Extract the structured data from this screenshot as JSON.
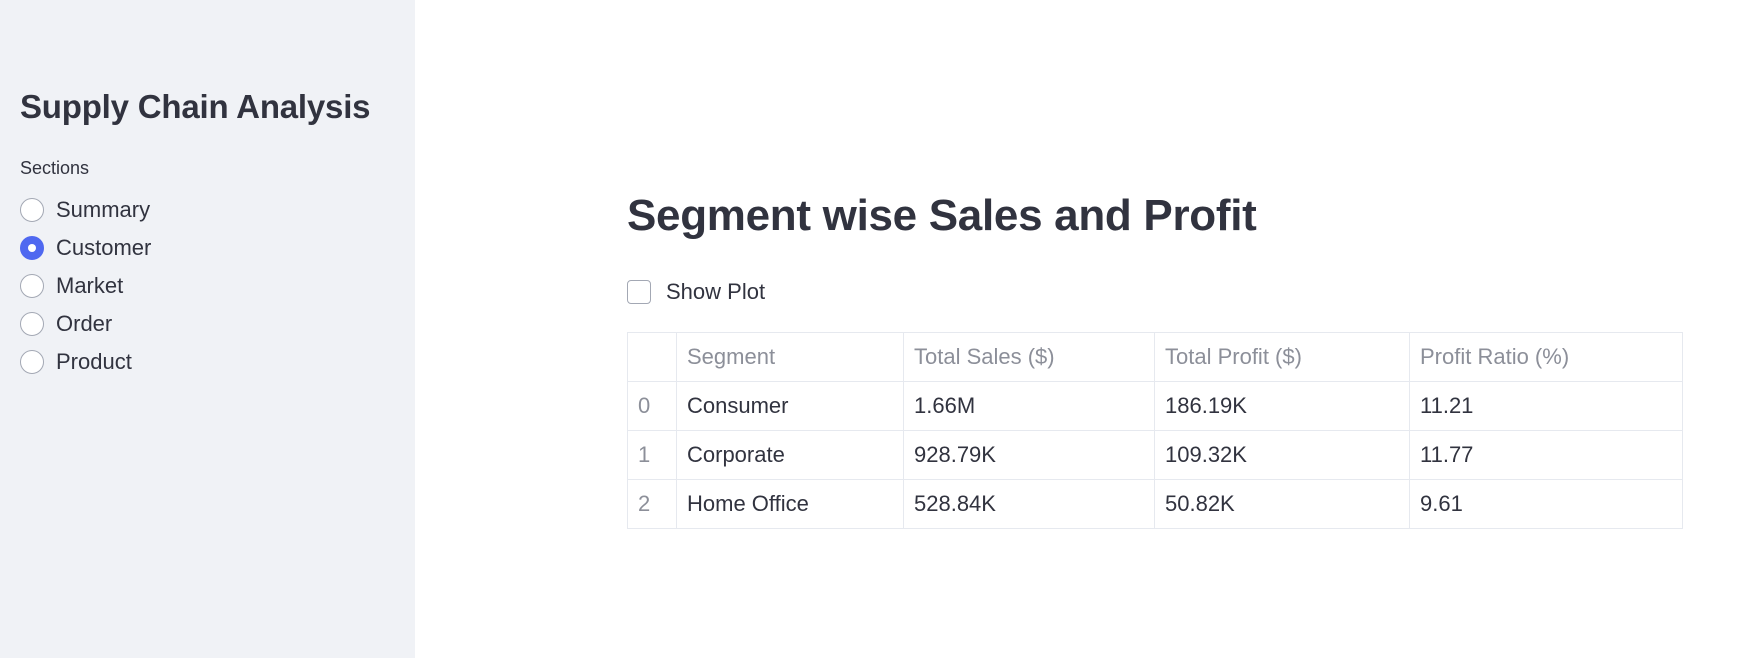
{
  "sidebar": {
    "title": "Supply Chain Analysis",
    "radio_label": "Sections",
    "options": [
      {
        "label": "Summary",
        "selected": false
      },
      {
        "label": "Customer",
        "selected": true
      },
      {
        "label": "Market",
        "selected": false
      },
      {
        "label": "Order",
        "selected": false
      },
      {
        "label": "Product",
        "selected": false
      }
    ]
  },
  "main": {
    "title": "Segment wise Sales and Profit",
    "checkbox": {
      "label": "Show Plot",
      "checked": false
    },
    "table": {
      "columns": [
        "",
        "Segment",
        "Total Sales ($)",
        "Total Profit ($)",
        "Profit Ratio (%)"
      ],
      "rows": [
        [
          "0",
          "Consumer",
          "1.66M",
          "186.19K",
          "11.21"
        ],
        [
          "1",
          "Corporate",
          "928.79K",
          "109.32K",
          "11.77"
        ],
        [
          "2",
          "Home Office",
          "528.84K",
          "50.82K",
          "9.61"
        ]
      ]
    }
  },
  "colors": {
    "accent": "#4f68f0",
    "sidebar_bg": "#f0f2f6",
    "text": "#31333f",
    "muted_text": "#8c8f99"
  }
}
